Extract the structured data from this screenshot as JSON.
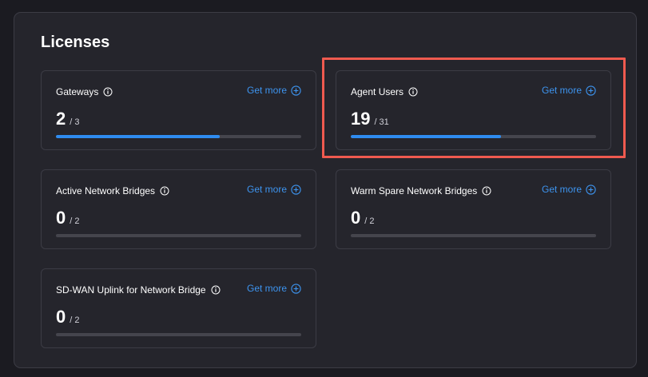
{
  "panel": {
    "title": "Licenses"
  },
  "cards": [
    {
      "name": "Gateways",
      "get_more": "Get more",
      "used": "2",
      "total": "3",
      "fill": 0.667
    },
    {
      "name": "Agent Users",
      "get_more": "Get more",
      "used": "19",
      "total": "31",
      "fill": 0.613
    },
    {
      "name": "Active Network Bridges",
      "get_more": "Get more",
      "used": "0",
      "total": "2",
      "fill": 0
    },
    {
      "name": "Warm Spare Network Bridges",
      "get_more": "Get more",
      "used": "0",
      "total": "2",
      "fill": 0
    },
    {
      "name": "SD-WAN Uplink for Network Bridge",
      "get_more": "Get more",
      "used": "0",
      "total": "2",
      "fill": 0
    }
  ],
  "colors": {
    "accent": "#3d94ef",
    "bar_fill": "#2f8cf0",
    "highlight": "#ef5a4f"
  }
}
